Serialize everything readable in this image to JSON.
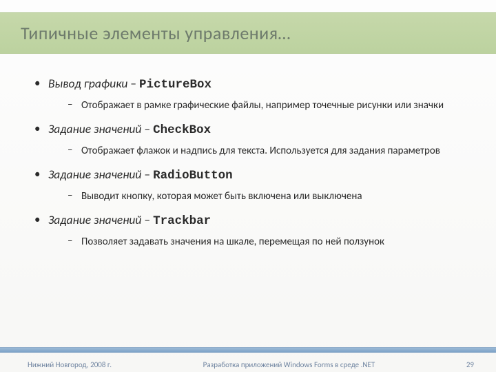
{
  "title": "Типичные элементы управления…",
  "items": [
    {
      "lead": "Вывод графики",
      "dash": " – ",
      "ctl": "PictureBox",
      "desc": "Отображает в рамке графические файлы, например точечные рисунки или значки"
    },
    {
      "lead": "Задание значений",
      "dash": " – ",
      "ctl": "CheckBox",
      "desc": "Отображает флажок и надпись для текста. Используется для задания параметров"
    },
    {
      "lead": "Задание значений",
      "dash": " – ",
      "ctl": "RadioButton",
      "desc": "Выводит кнопку, которая может быть включена или выключена"
    },
    {
      "lead": "Задание значений",
      "dash": " – ",
      "ctl": "Trackbar",
      "desc": "Позволяет задавать значения на шкале, перемещая по ней ползунок"
    }
  ],
  "footer": {
    "left": "Нижний Новгород, 2008 г.",
    "center": "Разработка приложений Windows Forms в среде .NET",
    "page": "29"
  },
  "glyphs": {
    "bullet1": "•",
    "bullet2": "–"
  }
}
